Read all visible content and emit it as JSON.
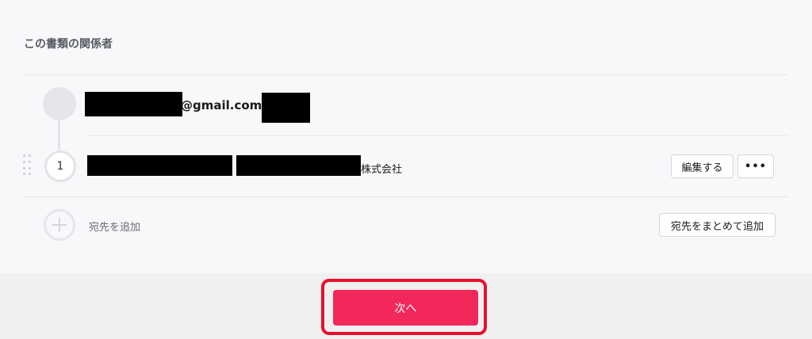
{
  "section": {
    "title": "この書類の関係者"
  },
  "sender": {
    "email_suffix": "@gmail.com"
  },
  "recipient": {
    "order": "1",
    "company_suffix": "株式会社"
  },
  "buttons": {
    "edit_label": "編集する",
    "more_label": "•••",
    "bulk_add_label": "宛先をまとめて追加",
    "next_label": "次へ"
  },
  "add_recipient": {
    "label": "宛先を追加"
  },
  "colors": {
    "primary": "#f2285a",
    "highlight_border": "#e8102c",
    "redaction": "#000000"
  }
}
